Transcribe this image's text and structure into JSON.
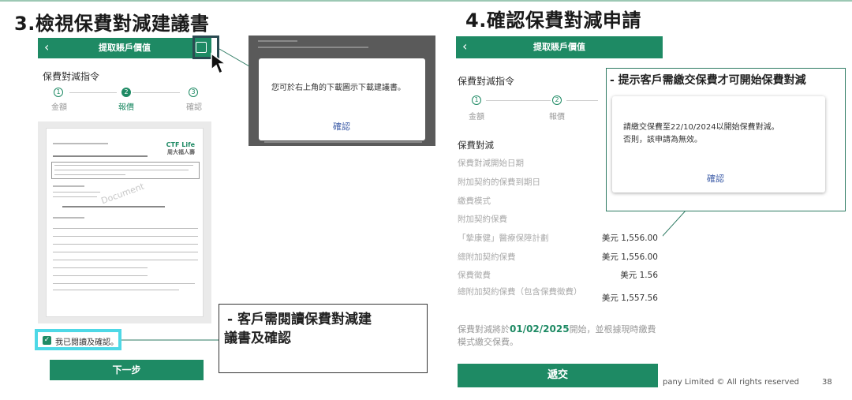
{
  "slide": {
    "step3_title": "3.檢視保費對減建議書",
    "step4_title": "4.確認保費對減申請",
    "footer": "pany Limited © All rights reserved",
    "page_number": "38",
    "accent_color": "#1e8a64",
    "highlight_color": "#4ed8e6"
  },
  "left_phone": {
    "app_title": "提取賬戶價值",
    "section_title": "保費對減指令",
    "steps": [
      {
        "num": "1",
        "label": "金額"
      },
      {
        "num": "2",
        "label": "報價"
      },
      {
        "num": "3",
        "label": "確認"
      }
    ],
    "document": {
      "logo": "CTF Life",
      "logo_sub": "周大福人壽",
      "watermark": "Document"
    },
    "agree_label": "我已閱讀及確認。",
    "next_button": "下一步",
    "popup": {
      "message": "您可於右上角的下載圖示下載建議書。",
      "confirm": "確認"
    }
  },
  "left_callout": {
    "line1": "- 客戶需閱讀保費對減建",
    "line2": "議書及確認"
  },
  "right_phone": {
    "app_title": "提取賬戶價值",
    "section_title": "保費對減指令",
    "steps": [
      {
        "num": "1",
        "label": "金額"
      },
      {
        "num": "2",
        "label": "報價"
      }
    ],
    "rows": [
      {
        "label": "保費對減",
        "value": "",
        "head": true
      },
      {
        "label": "保費對減開始日期",
        "value": ""
      },
      {
        "label": "附加契約的保費到期日",
        "value": ""
      },
      {
        "label": "繳費模式",
        "value": ""
      },
      {
        "label": "附加契約保費",
        "value": ""
      },
      {
        "label": "「摯康健」醫療保障計劃",
        "value": "美元 1,556.00"
      },
      {
        "label": "總附加契約保費",
        "value": "美元 1,556.00"
      },
      {
        "label": "保費徵費",
        "value": "美元 1.56"
      },
      {
        "label": "總附加契約保費（包含保費徵費）",
        "value": "美元 1,557.56"
      }
    ],
    "note_prefix": "保費對減將於",
    "note_date": "01/02/2025",
    "note_suffix": "開始，並根據現時繳費模式繳交保費。",
    "submit_button": "遞交"
  },
  "right_callout": {
    "title": "- 提示客戶需繳交保費才可開始保費對減",
    "dialog_line1": "請繳交保費至22/10/2024以開始保費對減。",
    "dialog_line2": "否則，該申請為無效。",
    "confirm": "確認"
  }
}
